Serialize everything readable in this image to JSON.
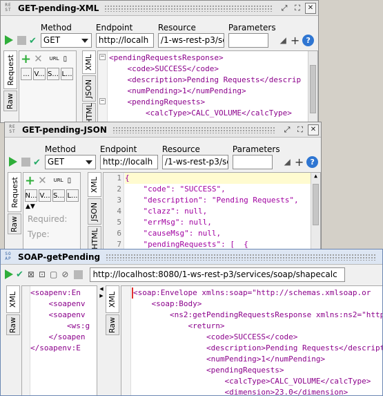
{
  "windows": {
    "xml": {
      "title": "GET-pending-XML",
      "method_label": "Method",
      "method": "GET",
      "endpoint_label": "Endpoint",
      "endpoint": "http://localh",
      "resource_label": "Resource",
      "resource": "/1-ws-rest-p3/se",
      "parameters_label": "Parameters",
      "parameters": "",
      "tabs_left": [
        "Request",
        "Raw"
      ],
      "tabs_right": [
        "XML",
        "JSON",
        "HTML"
      ],
      "param_cols": [
        "...",
        "V...",
        "S...",
        "L..."
      ],
      "lines": [
        "<pendingRequestsResponse>",
        "    <code>SUCCESS</code>",
        "    <description>Pending Requests</descrip",
        "    <numPending>1</numPending>",
        "    <pendingRequests>",
        "        <calcType>CALC_VOLUME</calcType>"
      ]
    },
    "json": {
      "title": "GET-pending-JSON",
      "method_label": "Method",
      "method": "GET",
      "endpoint_label": "Endpoint",
      "endpoint": "http://localh",
      "resource_label": "Resource",
      "resource": "/1-ws-rest-p3/se",
      "parameters_label": "Parameters",
      "parameters": "",
      "tabs_left": [
        "Request",
        "Raw"
      ],
      "tabs_right": [
        "XML",
        "JSON",
        "HTML"
      ],
      "param_cols": [
        "N...",
        "V...",
        "S...",
        "L..."
      ],
      "required_label": "Required:",
      "type_label": "Type:",
      "line_numbers": [
        "1",
        "2",
        "3",
        "4",
        "5",
        "6",
        "7"
      ],
      "lines": [
        "{",
        "    \"code\": \"SUCCESS\",",
        "    \"description\": \"Pending Requests\",",
        "    \"clazz\": null,",
        "    \"errMsg\": null,",
        "    \"causeMsg\": null,",
        "    \"pendingRequests\": [  {"
      ]
    },
    "soap": {
      "title": "SOAP-getPending",
      "endpoint": "http://localhost:8080/1-ws-rest-p3/services/soap/shapecalc",
      "left_tabs": [
        "XML",
        "Raw"
      ],
      "right_tabs": [
        "XML",
        "Raw"
      ],
      "request_lines": [
        "<soapenv:En",
        "    <soapenv",
        "    <soapenv",
        "        <ws:g",
        "    </soapen",
        "</soapenv:E"
      ],
      "response_lines": [
        "<soap:Envelope xmlns:soap=\"http://schemas.xmlsoap.or",
        "    <soap:Body>",
        "        <ns2:getPendingRequestsResponse xmlns:ns2=\"http",
        "            <return>",
        "                <code>SUCCESS</code>",
        "                <description>Pending Requests</descripti",
        "                <numPending>1</numPending>",
        "                <pendingRequests>",
        "                    <calcType>CALC_VOLUME</calcType>",
        "                    <dimension>23.0</dimension>"
      ]
    }
  },
  "colors": {
    "accent": "#2f76d2",
    "play": "#2fae3a",
    "json_highlight": "#fffbd0",
    "xml_tag": "#8b008b",
    "xml_attr": "#006400"
  },
  "icons": {
    "play": "play-icon",
    "stop": "stop-icon",
    "validate": "check-icon",
    "help": "help-icon",
    "maximize": "maximize-icon",
    "detach": "detach-icon",
    "close": "close-icon"
  }
}
